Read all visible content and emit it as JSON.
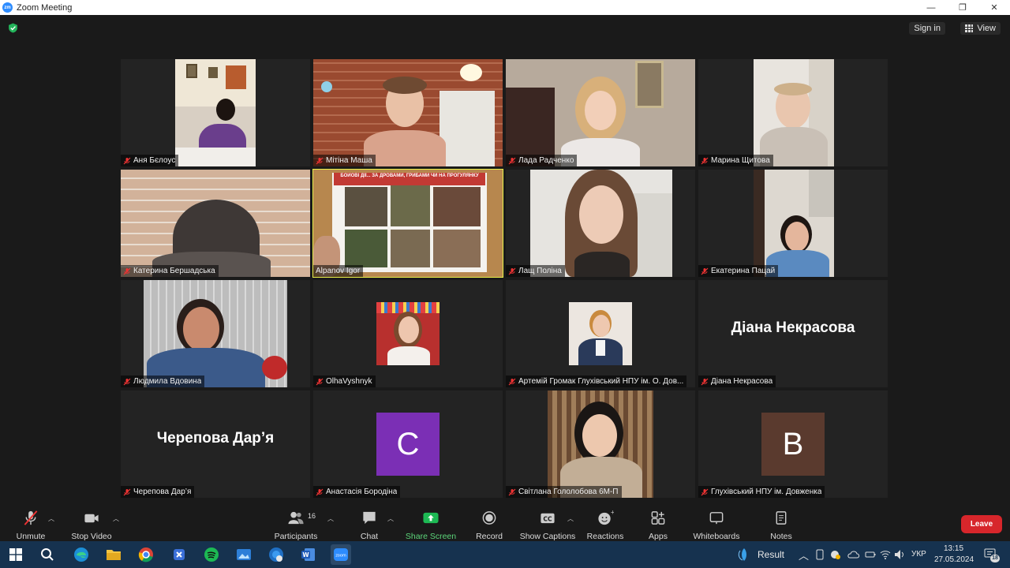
{
  "window": {
    "title": "Zoom Meeting",
    "logo_text": "zm",
    "controls": [
      "—",
      "❐",
      "✕"
    ]
  },
  "topbar": {
    "signin_label": "Sign in",
    "view_label": "View"
  },
  "participants": [
    {
      "name": "Аня Бєлоус",
      "type": "video"
    },
    {
      "name": "Мітіна Маша",
      "type": "video"
    },
    {
      "name": "Лада Радченко",
      "type": "video"
    },
    {
      "name": "Марина Щитова",
      "type": "video"
    },
    {
      "name": "Катерина Бершадська",
      "type": "video"
    },
    {
      "name": "Alpanov Igor",
      "type": "video",
      "active_speaker": true,
      "poster_text": "БОЙОВІ ДІЇ... ЗА ДРОВАМИ, ГРИБАМИ ЧИ НА ПРОГУЛЯНКУ"
    },
    {
      "name": "Лащ Поліна",
      "type": "video"
    },
    {
      "name": "Екатерина Пацай",
      "type": "video"
    },
    {
      "name": "Людмила Вдовина",
      "type": "video"
    },
    {
      "name": "OlhaVyshnyk",
      "type": "photo"
    },
    {
      "name": "Артемій Громак Глухівський НПУ ім. О. Дов...",
      "type": "photo"
    },
    {
      "name": "Діана Некрасова",
      "type": "name",
      "display": "Діана Некрасова"
    },
    {
      "name": "Черепова Дар’я",
      "type": "name",
      "display": "Черепова Дар’я"
    },
    {
      "name": "Анастасія Бородіна",
      "type": "avatar",
      "letter": "C",
      "color": "#7b2fb5"
    },
    {
      "name": "Світлана Гололобова 6М-П",
      "type": "video"
    },
    {
      "name": "Глухівський НПУ ім. Довженка",
      "type": "avatar",
      "letter": "B",
      "color": "#5a3a2e"
    }
  ],
  "toolbar": {
    "unmute": "Unmute",
    "stop_video": "Stop Video",
    "participants": "Participants",
    "participants_count": "16",
    "chat": "Chat",
    "share_screen": "Share Screen",
    "record": "Record",
    "show_captions": "Show Captions",
    "reactions": "Reactions",
    "apps": "Apps",
    "whiteboards": "Whiteboards",
    "notes": "Notes",
    "leave": "Leave"
  },
  "taskbar": {
    "weather": "Result",
    "language": "УКР",
    "time": "13:15",
    "date": "27.05.2024",
    "notifications": "18"
  },
  "colors": {
    "accent": "#2d8cff",
    "share_green": "#1db954",
    "leave_red": "#d7262b",
    "active_outline": "#e8f04a"
  }
}
